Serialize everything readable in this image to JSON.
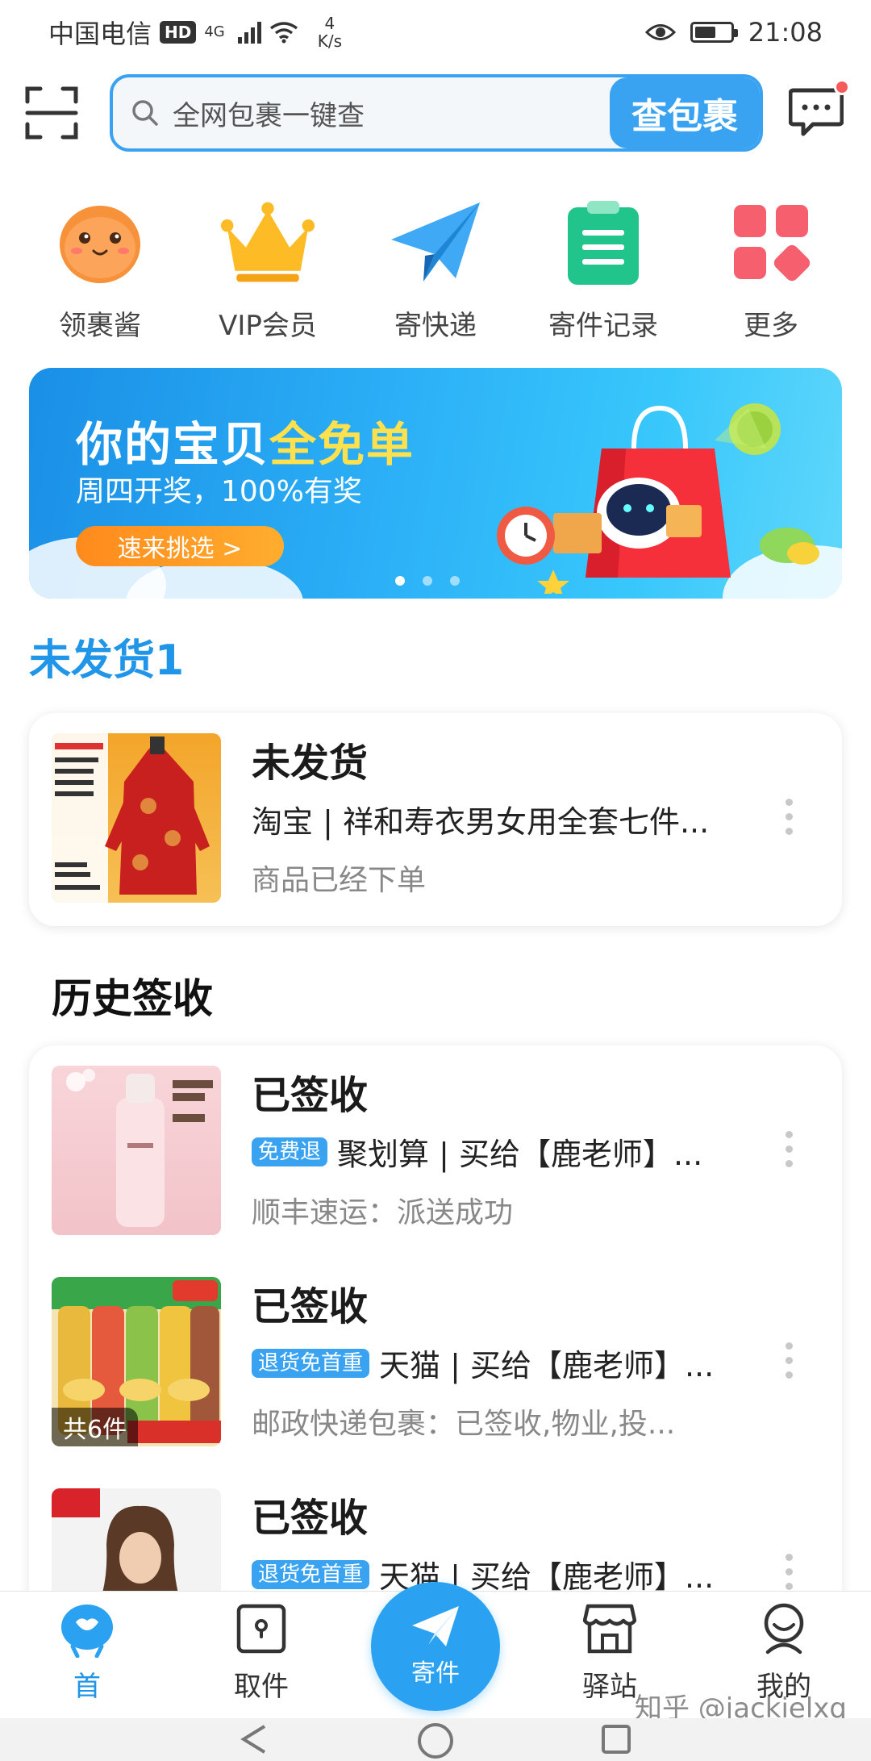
{
  "status_bar": {
    "carrier": "中国电信",
    "hd": "HD",
    "net_type": "4G",
    "speed_value": "4",
    "speed_unit": "K/s",
    "time": "21:08"
  },
  "header": {
    "search_placeholder": "全网包裹一键查",
    "search_button": "查包裹"
  },
  "quick_menu": [
    {
      "label": "领裹酱",
      "icon": "mascot-icon"
    },
    {
      "label": "VIP会员",
      "icon": "crown-icon"
    },
    {
      "label": "寄快递",
      "icon": "paper-plane-icon"
    },
    {
      "label": "寄件记录",
      "icon": "clipboard-icon"
    },
    {
      "label": "更多",
      "icon": "grid-icon"
    }
  ],
  "banner": {
    "title_main": "你的宝贝",
    "title_highlight": "全免单",
    "subtitle": "周四开奖，100%有奖",
    "cta": "速来挑选 >",
    "active_dot": 1
  },
  "pending": {
    "section_title": "未发货1",
    "items": [
      {
        "status": "未发货",
        "detail": "淘宝 | 祥和寿衣男女用全套七件...",
        "note": "商品已经下单"
      }
    ]
  },
  "history": {
    "section_title": "历史签收",
    "items": [
      {
        "status": "已签收",
        "tag": "免费退",
        "detail": "聚划算 | 买给【鹿老师】...",
        "note": "顺丰速运：派送成功"
      },
      {
        "status": "已签收",
        "tag": "退货免首重",
        "detail": "天猫 | 买给【鹿老师】...",
        "note": "邮政快递包裹：已签收,物业,投...",
        "count": "共6件"
      },
      {
        "status": "已签收",
        "tag": "退货免首重",
        "detail": "天猫 | 买给【鹿老师】..."
      }
    ]
  },
  "bottom_nav": {
    "home": "首",
    "pickup": "取件",
    "send": "寄件",
    "station": "驿站",
    "mine": "我的"
  },
  "watermark": "知乎 @jackielxq",
  "colors": {
    "accent": "#39a3f2",
    "section_blue": "#2196e8",
    "text_dark": "#1b1b1b",
    "text_gray": "#888888"
  }
}
